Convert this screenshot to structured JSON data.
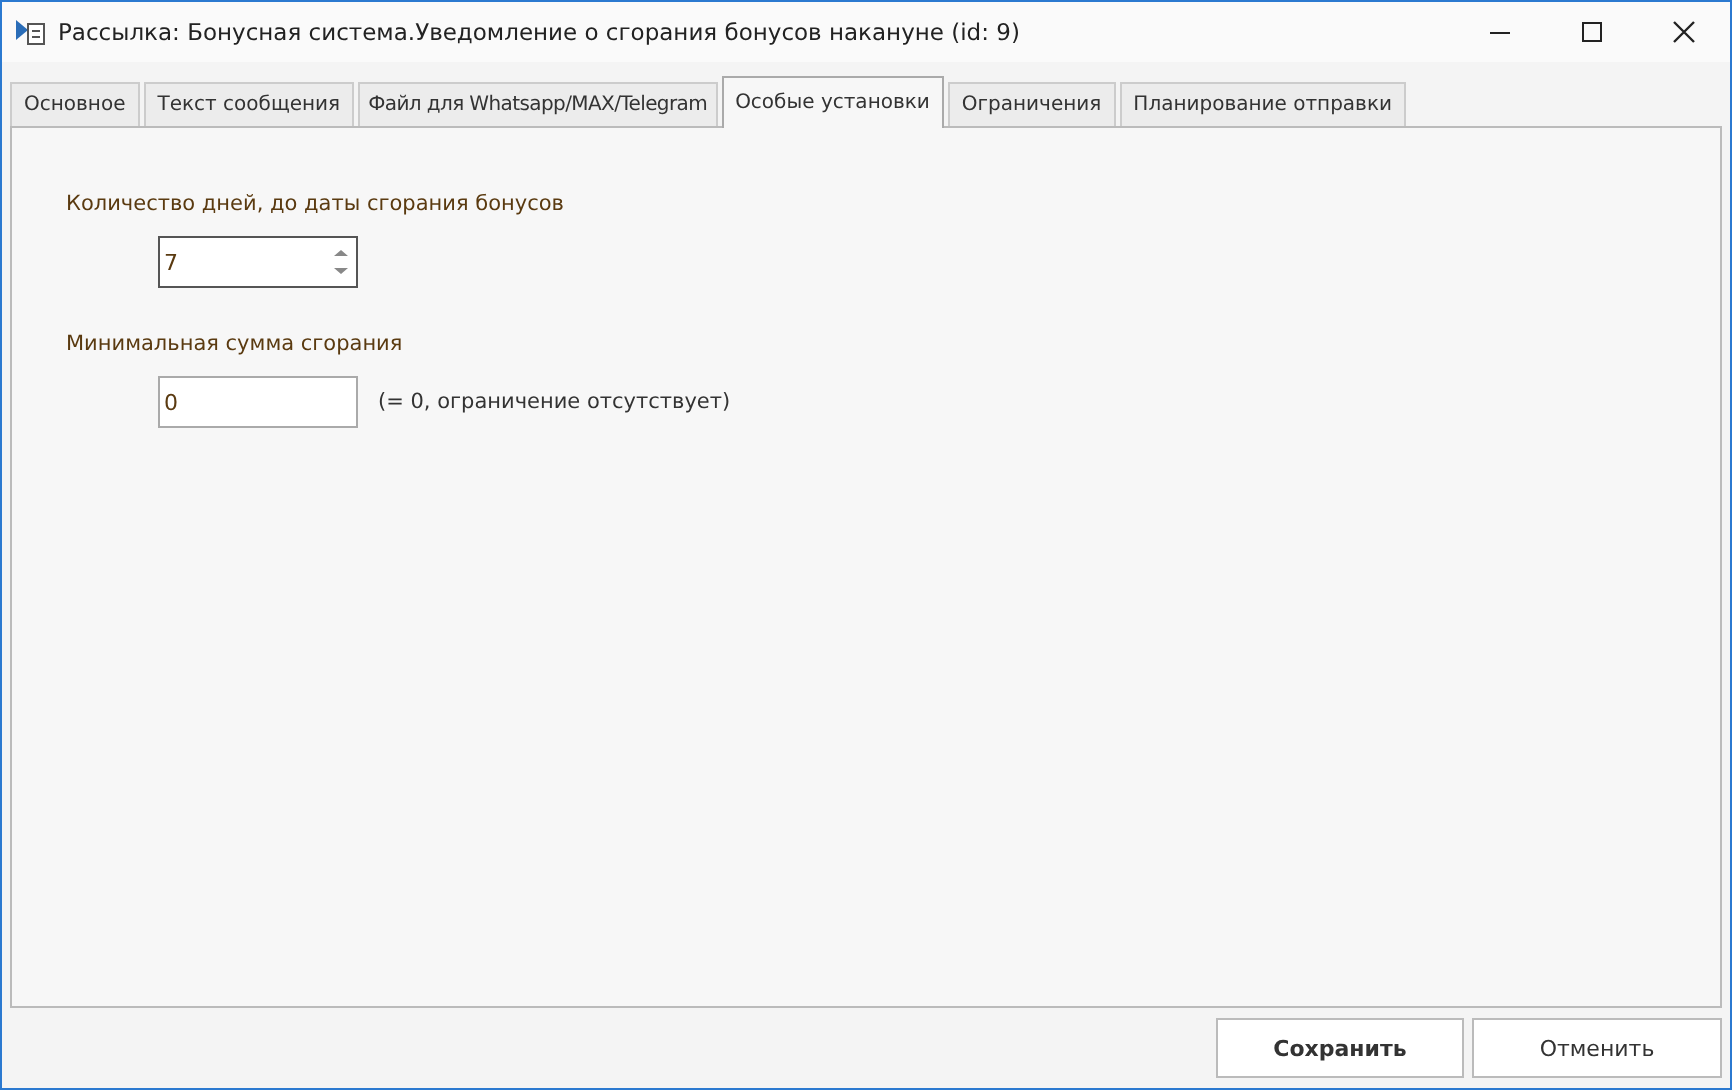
{
  "window": {
    "title": "Рассылка: Бонусная система.Уведомление о сгорания бонусов накануне (id: 9)"
  },
  "tabs": [
    {
      "label": "Основное",
      "selected": false
    },
    {
      "label": "Текст сообщения",
      "selected": false
    },
    {
      "label": "Файл для Whatsapp/MAX/Telegram",
      "selected": false
    },
    {
      "label": "Особые установки",
      "selected": true
    },
    {
      "label": "Ограничения",
      "selected": false
    },
    {
      "label": "Планирование отправки",
      "selected": false
    }
  ],
  "fields": [
    {
      "kind": "spinner",
      "label": "Количество дней, до даты сгорания бонусов",
      "value": "7"
    },
    {
      "kind": "text",
      "label": "Минимальная сумма сгорания",
      "value": "0",
      "hint": "(= 0, ограничение отсутствует)"
    }
  ],
  "buttons": [
    {
      "label": "Сохранить",
      "kind": "primary"
    },
    {
      "label": "Отменить",
      "kind": "normal"
    }
  ]
}
